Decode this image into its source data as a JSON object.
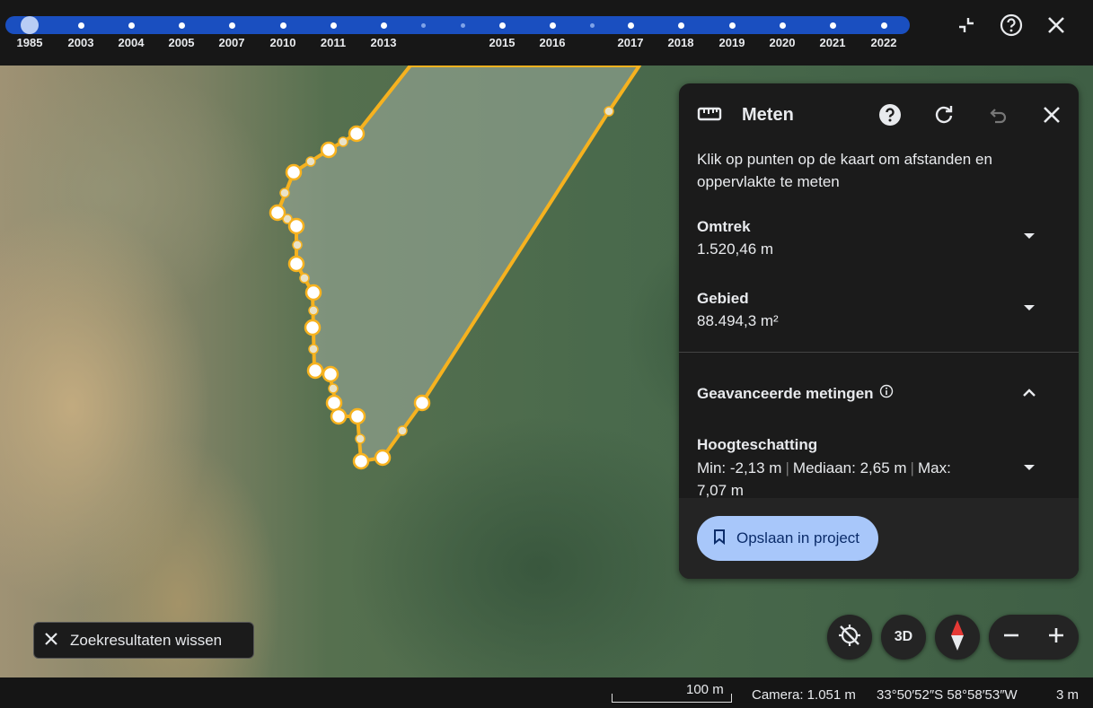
{
  "timeline": {
    "years": [
      "1985",
      "2003",
      "2004",
      "2005",
      "2007",
      "2010",
      "2011",
      "2013",
      "2015",
      "2016",
      "2017",
      "2018",
      "2019",
      "2020",
      "2021",
      "2022"
    ],
    "active_year": "1985"
  },
  "top_controls": {
    "icons": [
      "collapse-icon",
      "help-icon",
      "close-icon"
    ]
  },
  "panel": {
    "title": "Meten",
    "description": "Klik op punten op de kaart om afstanden en oppervlakte te meten",
    "perimeter": {
      "label": "Omtrek",
      "value": "1.520,46 m"
    },
    "area": {
      "label": "Gebied",
      "value": "88.494,3 m²"
    },
    "advanced_title": "Geavanceerde metingen",
    "height": {
      "label": "Hoogteschatting",
      "min": "Min: -2,13 m",
      "median": "Mediaan: 2,65 m",
      "max": "Max: 7,07 m"
    },
    "save_label": "Opslaan in project"
  },
  "bottom": {
    "clear_label": "Zoekresultaten wissen",
    "btn_3d": "3D"
  },
  "statusbar": {
    "scale": "100 m",
    "camera": "Camera: 1.051 m",
    "coords": "33°50′52″S 58°58′53″W",
    "elevation": "3 m"
  },
  "colors": {
    "accent": "#a8c7fa",
    "timeline": "#1a4fc0",
    "measure_line": "#f6b21f"
  }
}
